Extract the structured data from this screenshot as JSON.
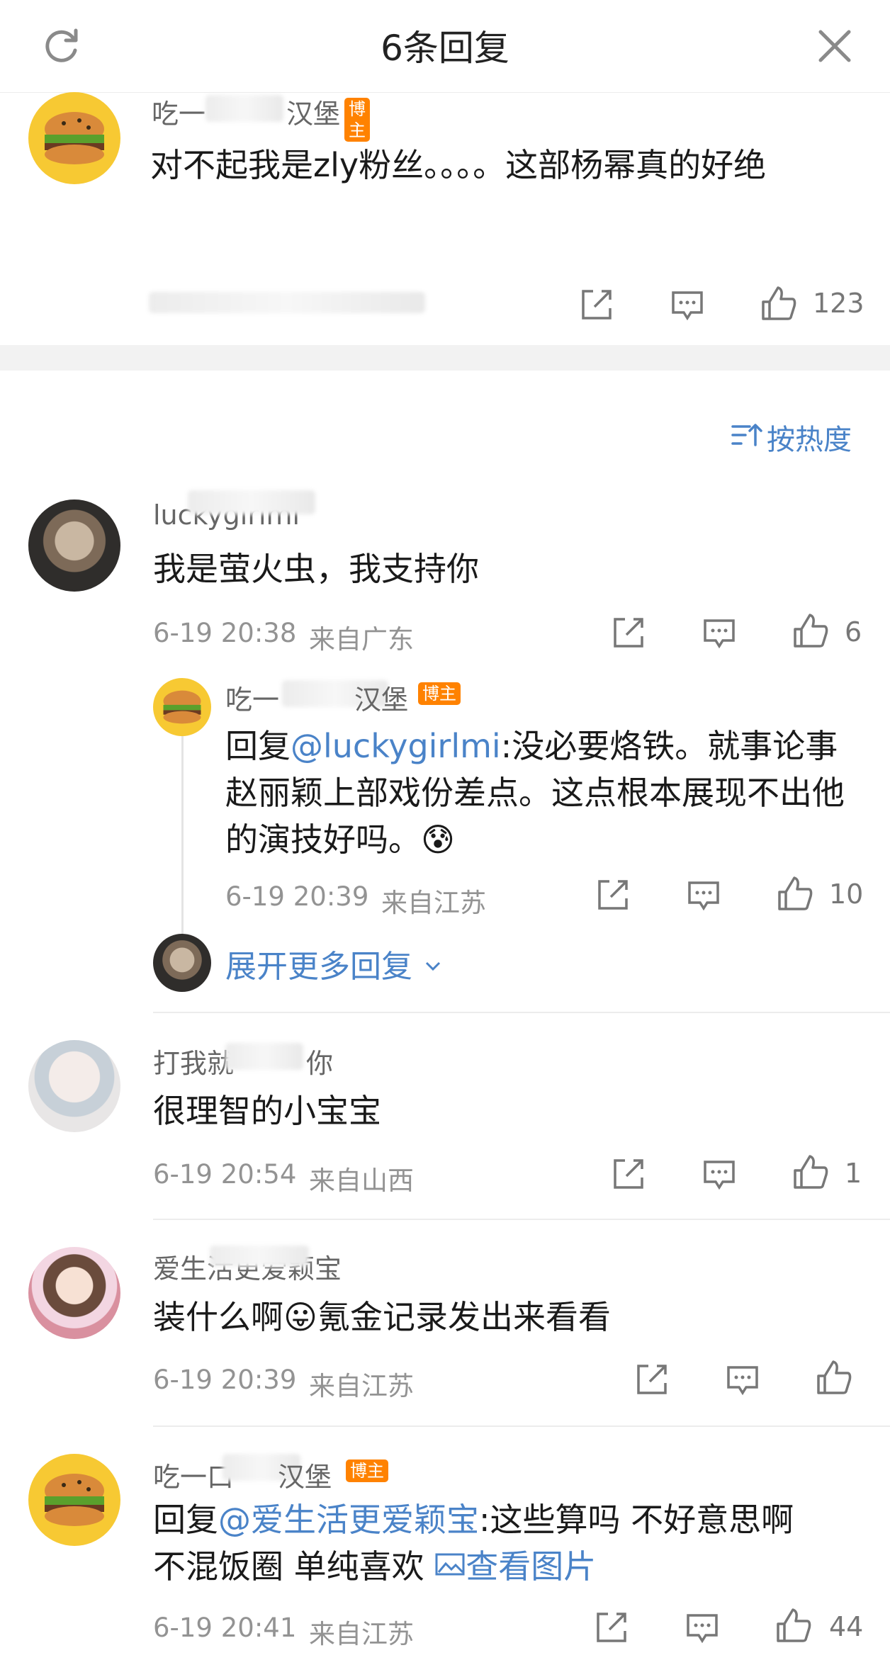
{
  "header": {
    "title": "6条回复",
    "refresh_icon": "refresh-icon",
    "close_icon": "close-icon"
  },
  "root_comment": {
    "user": "吃一口汉堡",
    "name_visible_a": "吃一",
    "name_visible_b": "汉堡",
    "badge": "博主",
    "text": "对不起我是zly粉丝。。。。这部杨幂真的好绝",
    "likes": "123"
  },
  "sort": {
    "label": "按热度",
    "icon": "sort-icon"
  },
  "comments": [
    {
      "user": "luckygirlmi",
      "text": "我是萤火虫，我支持你",
      "time": "6-19 20:38",
      "location": "来自广东",
      "likes": "6",
      "reply": {
        "name_visible_a": "吃一",
        "name_visible_b": "汉堡",
        "badge": "博主",
        "prefix": "回复",
        "mention": "@luckygirlmi",
        "text": ":没必要烙铁。就事论事 赵丽颖上部戏份差点。这点根本展现不出他的演技好吗。",
        "emoji": "😰",
        "time": "6-19 20:39",
        "location": "来自江苏",
        "likes": "10"
      },
      "expand_label": "展开更多回复"
    },
    {
      "user": "打我就打哭你",
      "name_visible_a": "打我就",
      "name_visible_b": "你",
      "text": "很理智的小宝宝",
      "time": "6-19 20:54",
      "location": "来自山西",
      "likes": "1"
    },
    {
      "user": "爱生活更爱颖宝",
      "text_a": "装什么啊",
      "emoji": "😛",
      "text_b": "氪金记录发出来看看",
      "time": "6-19 20:39",
      "location": "来自江苏",
      "likes": ""
    },
    {
      "name_visible_a": "吃一口",
      "name_visible_b": "汉堡",
      "badge": "博主",
      "prefix": "回复",
      "mention": "@爱生活更爱颖宝",
      "text_a": ":这些算吗 不好意思啊",
      "text_b": "不混饭圈 单纯喜欢 ",
      "image_link": "查看图片",
      "image_icon": "image-icon",
      "time": "6-19 20:41",
      "location": "来自江苏",
      "likes": "44"
    }
  ]
}
